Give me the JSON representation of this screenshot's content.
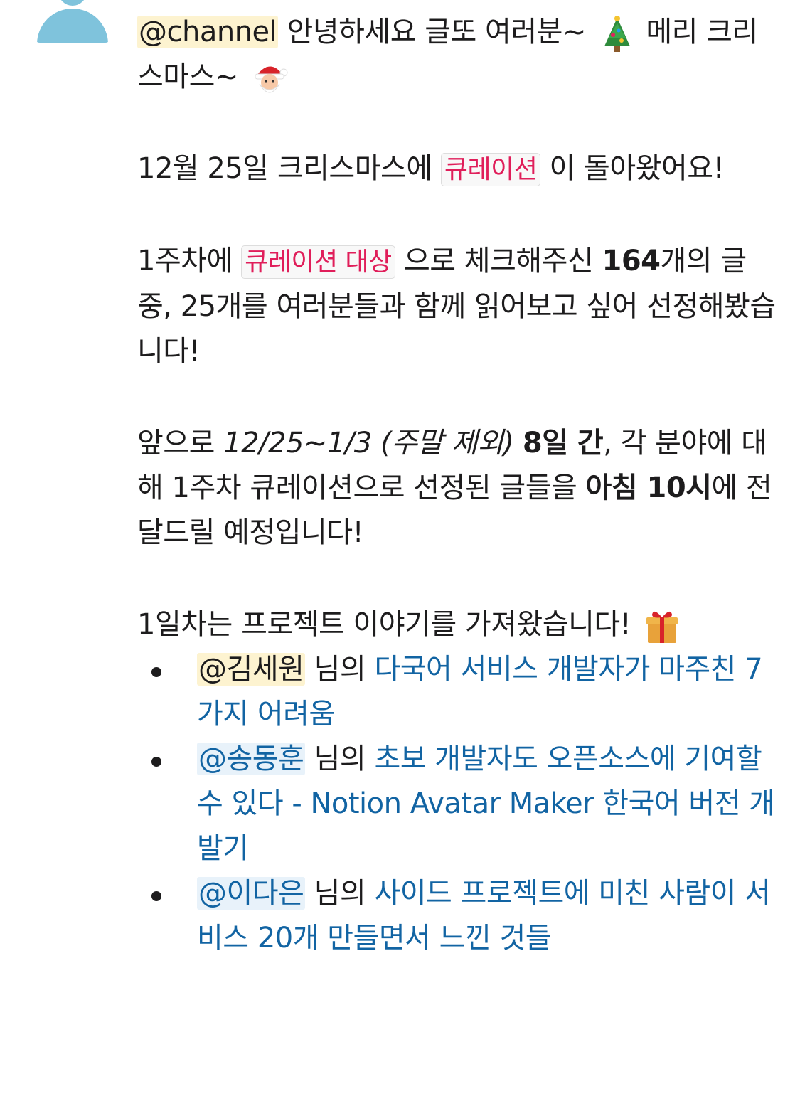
{
  "message": {
    "line1": {
      "mention": "@channel",
      "text": " 안녕하세요 글또 여러분~ ",
      "emoji1": "christmas-tree-icon",
      "text2": " 메리 크리스마스~ ",
      "emoji2": "santa-icon"
    },
    "para2": {
      "text1": "12월 25일 크리스마스에 ",
      "code": "큐레이션",
      "text2": " 이 돌아왔어요!"
    },
    "para3": {
      "text1": "1주차에 ",
      "code": "큐레이션  대상",
      "text2": " 으로 체크해주신 ",
      "bold": "164",
      "text3": "개의 글 중, 25개를 여러분들과 함께 읽어보고 싶어 선정해봤습니다!"
    },
    "para4": {
      "text1": "앞으로 ",
      "italic1": "12/25~1/3",
      "italic2": " (주말 제외)",
      "text_space": " ",
      "bold1": "8일 간",
      "text2": ", 각 분야에 대해 1주차 큐레이션으로 선정된 글들을 ",
      "bold2": "아침 10시",
      "text3": "에 전달드릴 예정입니다!"
    },
    "para5": {
      "text": "1일차는 프로젝트 이야기를 가져왔습니다! ",
      "emoji": "gift-icon"
    },
    "items": [
      {
        "mention": "@김세원",
        "mid": " 님의 ",
        "link": "다국어 서비스 개발자가 마주친 7가지 어려움"
      },
      {
        "mention": "@송동훈",
        "mid": " 님의 ",
        "link": "초보 개발자도 오픈소스에 기여할 수 있다 - Notion Avatar Maker 한국어 버전 개발기"
      },
      {
        "mention": "@이다은",
        "mid": " 님의 ",
        "link": "사이드 프로젝트에 미친 사람이 서비스 20개 만들면서 느낀 것들"
      }
    ]
  }
}
